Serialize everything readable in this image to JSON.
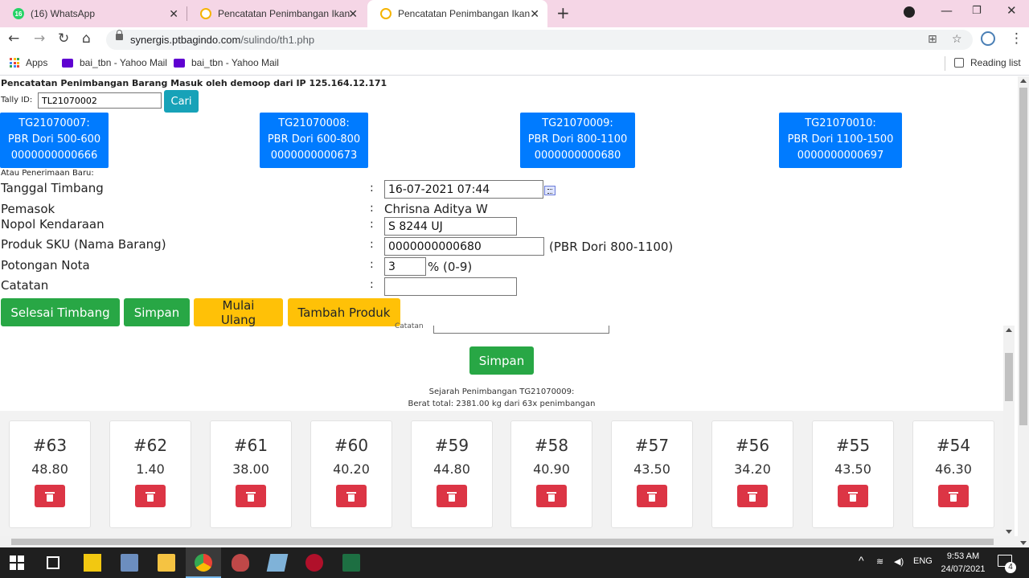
{
  "browser": {
    "tabs": [
      {
        "label": "(16) WhatsApp",
        "badge": "16"
      },
      {
        "label": "Pencatatan Penimbangan Ikan"
      },
      {
        "label": "Pencatatan Penimbangan Ikan"
      }
    ],
    "url_domain": "synergis.ptbagindo.com",
    "url_path": "/sulindo/th1.php",
    "bookmarks": [
      "Apps",
      "bai_tbn - Yahoo Mail",
      "bai_tbn - Yahoo Mail"
    ],
    "reading_list": "Reading list"
  },
  "page": {
    "header": "Pencatatan Penimbangan Barang Masuk oleh demoop dari IP 125.164.12.171",
    "tally_label": "Tally ID:",
    "tally_value": "TL21070002",
    "cari_label": "Cari",
    "tally_cards": [
      {
        "id": "TG21070007:",
        "product": "PBR Dori 500-600",
        "sku": "0000000000666"
      },
      {
        "id": "TG21070008:",
        "product": "PBR Dori 600-800",
        "sku": "0000000000673"
      },
      {
        "id": "TG21070009:",
        "product": "PBR Dori 800-1100",
        "sku": "0000000000680"
      },
      {
        "id": "TG21070010:",
        "product": "PBR Dori 1100-1500",
        "sku": "0000000000697"
      }
    ],
    "baru_label": "Atau Penerimaan Baru:",
    "form": {
      "tanggal_label": "Tanggal Timbang",
      "tanggal_value": "16-07-2021 07:44",
      "pemasok_label": "Pemasok",
      "pemasok_value": "Chrisna Aditya W",
      "nopol_label": "Nopol Kendaraan",
      "nopol_value": "S 8244 UJ",
      "produk_label": "Produk SKU (Nama Barang)",
      "produk_value": "0000000000680",
      "produk_name": "(PBR Dori 800-1100)",
      "potongan_label": "Potongan Nota",
      "potongan_value": "3",
      "potongan_suffix": "% (0-9)",
      "catatan_label": "Catatan",
      "catatan_value": "",
      "colon": ":"
    },
    "buttons": {
      "selesai": "Selesai Timbang",
      "simpan": "Simpan",
      "mulai_ulang": "Mulai Ulang",
      "tambah_produk": "Tambah Produk",
      "simpan2": "Simpan"
    },
    "hidden_label": "Catatan",
    "history_title": "Sejarah Penimbangan TG21070009:",
    "history_total": "Berat total: 2381.00 kg dari 63x penimbangan",
    "weighings": [
      {
        "num": "#63",
        "value": "48.80"
      },
      {
        "num": "#62",
        "value": "1.40"
      },
      {
        "num": "#61",
        "value": "38.00"
      },
      {
        "num": "#60",
        "value": "40.20"
      },
      {
        "num": "#59",
        "value": "44.80"
      },
      {
        "num": "#58",
        "value": "40.90"
      },
      {
        "num": "#57",
        "value": "43.50"
      },
      {
        "num": "#56",
        "value": "34.20"
      },
      {
        "num": "#55",
        "value": "43.50"
      },
      {
        "num": "#54",
        "value": "46.30"
      }
    ]
  },
  "taskbar": {
    "language": "ENG",
    "time": "9:53 AM",
    "date": "24/07/2021",
    "notifications": "4"
  },
  "colors": {
    "primary": "#007bff",
    "success": "#28a745",
    "warning": "#ffc107",
    "danger": "#dc3545",
    "info": "#17a2b8",
    "tabbar": "#f5d6e6"
  }
}
